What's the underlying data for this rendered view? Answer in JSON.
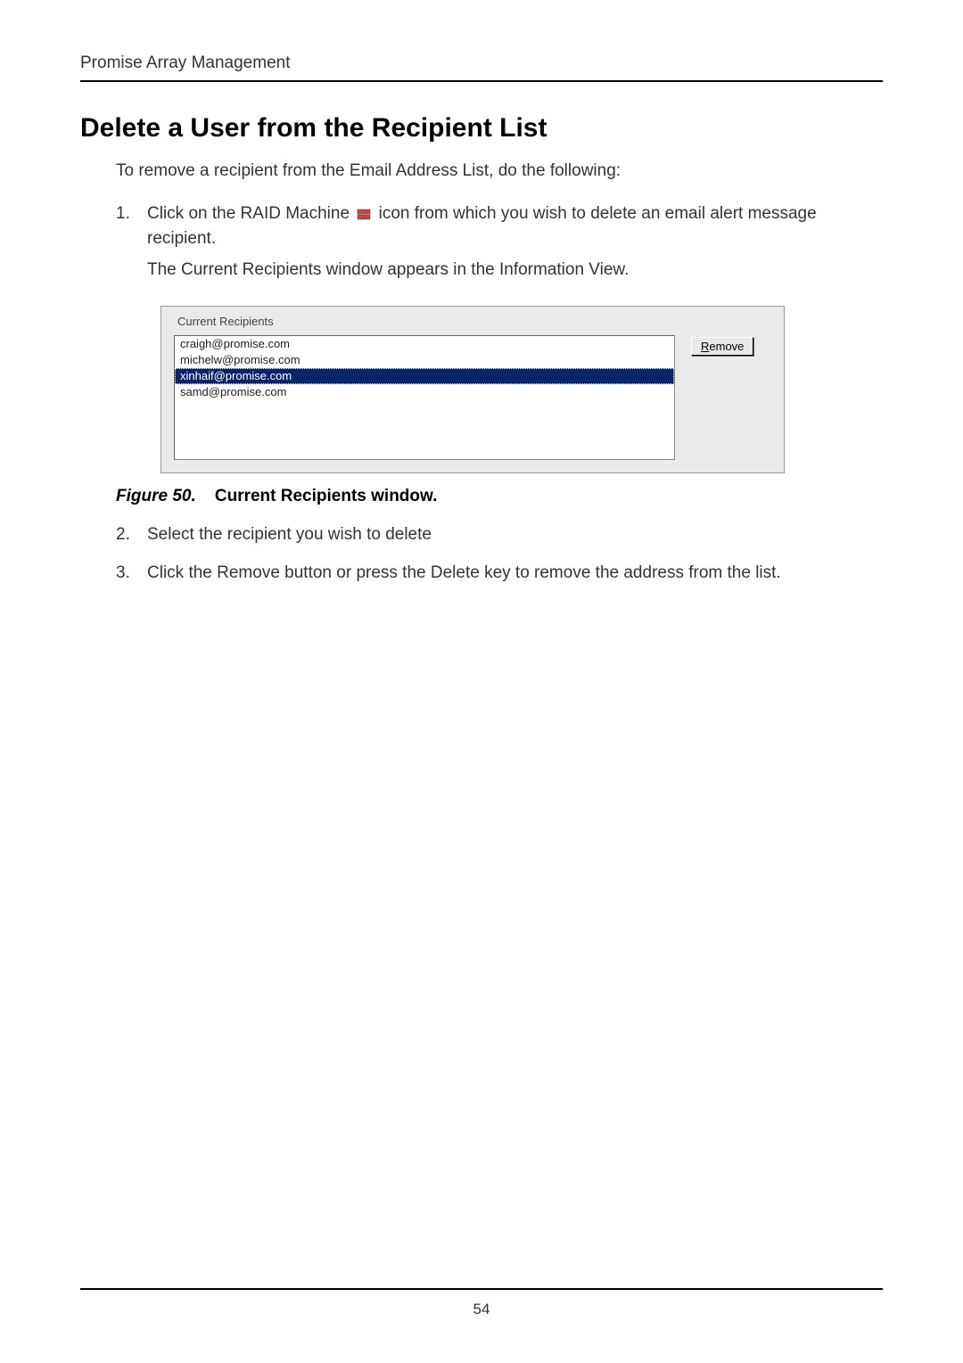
{
  "header": {
    "title": "Promise Array Management"
  },
  "content": {
    "heading": "Delete a User from the Recipient List",
    "intro": "To remove a recipient from the Email Address List, do the following:",
    "steps": [
      {
        "number": "1.",
        "text_before_icon": "Click on the RAID Machine ",
        "text_after_icon": " icon from which you wish to delete an email alert message recipient.",
        "extra": "The Current Recipients window appears in the Information View."
      },
      {
        "number": "2.",
        "text": "Select the recipient you wish to delete"
      },
      {
        "number": "3.",
        "text": "Click the Remove button or press the Delete key to remove the address from the list."
      }
    ]
  },
  "figure": {
    "legend": "Current Recipients",
    "recipients": [
      {
        "email": "craigh@promise.com",
        "selected": false
      },
      {
        "email": "michelw@promise.com",
        "selected": false
      },
      {
        "email": "xinhaif@promise.com",
        "selected": true
      },
      {
        "email": "samd@promise.com",
        "selected": false
      }
    ],
    "remove_button": {
      "accelerator": "R",
      "rest": "emove"
    },
    "caption_label": "Figure 50.",
    "caption_text": "Current Recipients window."
  },
  "footer": {
    "page_number": "54"
  }
}
